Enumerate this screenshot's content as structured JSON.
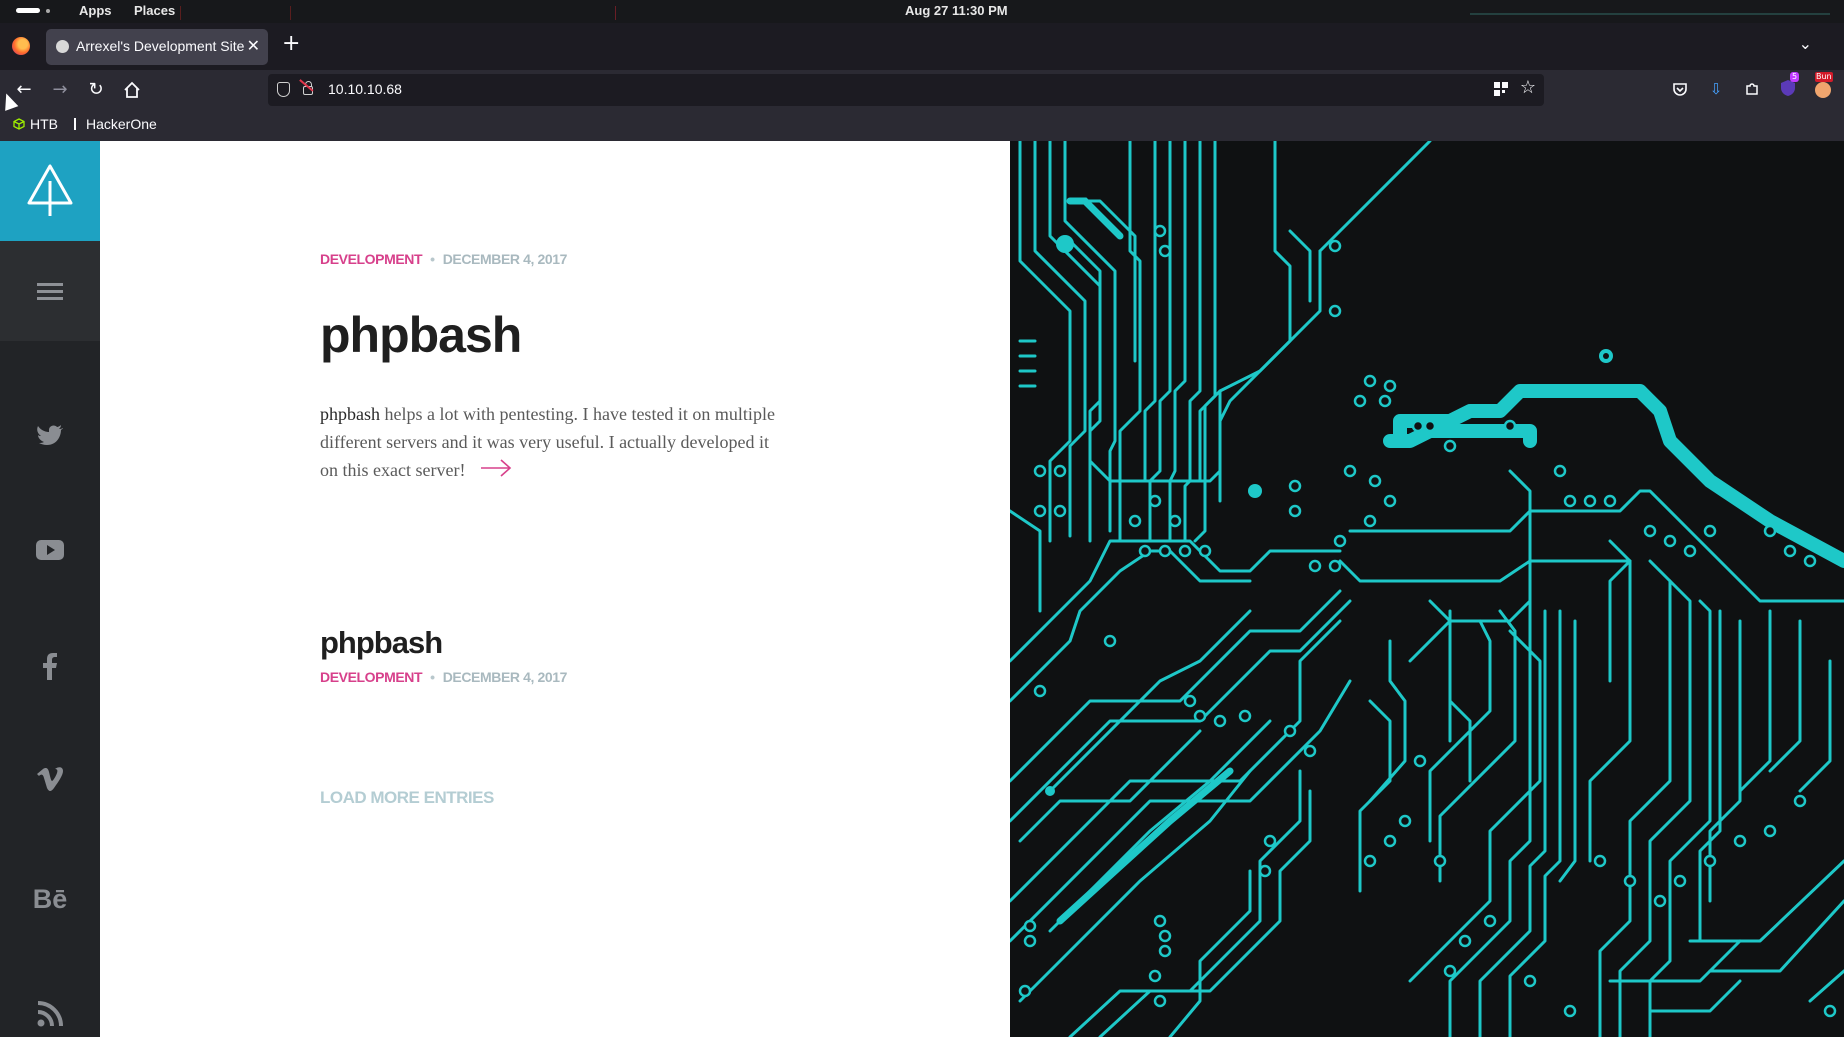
{
  "system_bar": {
    "apps_label": "Apps",
    "places_label": "Places",
    "clock": "Aug 27  11:30 PM"
  },
  "browser": {
    "tab_title": "Arrexel's Development Site",
    "url": "10.10.10.68",
    "bookmarks": [
      {
        "label": "HTB",
        "icon": "htb-cube-icon"
      },
      {
        "label": "HackerOne",
        "icon": "hackerone-icon"
      }
    ],
    "extension_badge": "5",
    "profile_badge": "Bun",
    "accent_color": "#1ea2c2"
  },
  "site": {
    "sidebar": {
      "logo_icon": "tree-triangle-icon",
      "menu_icon": "hamburger-icon",
      "social_icons": [
        "twitter-icon",
        "youtube-icon",
        "facebook-icon",
        "vimeo-icon",
        "behance-icon",
        "rss-icon"
      ],
      "behance_text": "Bē"
    },
    "featured_post": {
      "category": "DEVELOPMENT",
      "separator": "•",
      "date": "DECEMBER 4, 2017",
      "title": "phpbash",
      "excerpt_lead": "phpbash",
      "excerpt_rest": " helps a lot with pentesting. I have tested it on multiple different servers and it was very useful. I actually developed it on this exact server!"
    },
    "second_post": {
      "title": "phpbash",
      "category": "DEVELOPMENT",
      "separator": "•",
      "date": "DECEMBER 4, 2017"
    },
    "load_more_label": "LOAD MORE ENTRIES",
    "colors": {
      "category": "#d7408b",
      "date": "#a9b9bf",
      "hero_trace": "#1ec8c8",
      "hero_bg": "#0f1112"
    }
  }
}
